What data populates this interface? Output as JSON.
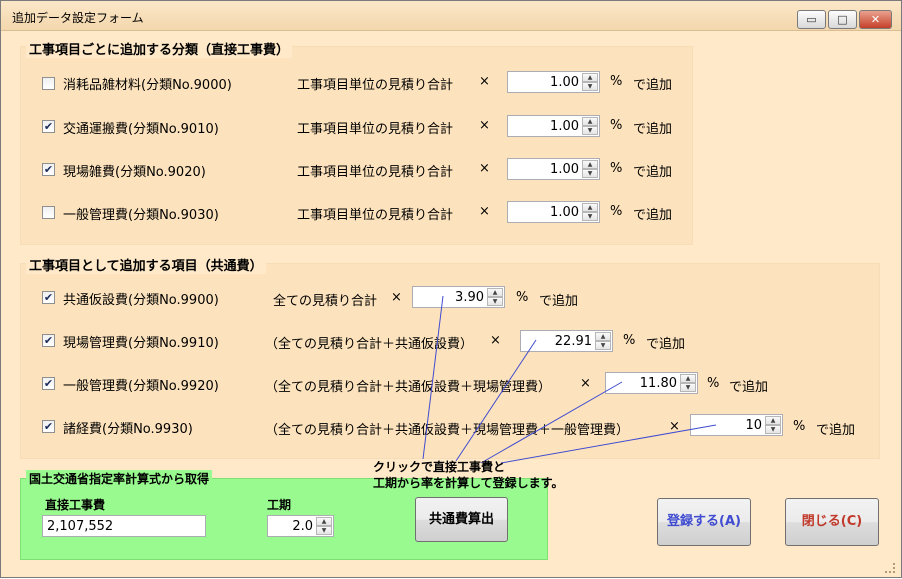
{
  "window": {
    "title": "追加データ設定フォーム",
    "min_glyph": "▭",
    "max_glyph": "□",
    "close_glyph": "✕"
  },
  "group1": {
    "title": "工事項目ごとに追加する分類（直接工事費）",
    "rows": [
      {
        "checked": false,
        "name": "消耗品雑材料(分類No.9000)",
        "formula": "工事項目単位の見積り合計",
        "times": "×",
        "value": "1.00",
        "unit": "%",
        "suffix": "で追加"
      },
      {
        "checked": true,
        "name": "交通運搬費(分類No.9010)",
        "formula": "工事項目単位の見積り合計",
        "times": "×",
        "value": "1.00",
        "unit": "%",
        "suffix": "で追加"
      },
      {
        "checked": true,
        "name": "現場雑費(分類No.9020)",
        "formula": "工事項目単位の見積り合計",
        "times": "×",
        "value": "1.00",
        "unit": "%",
        "suffix": "で追加"
      },
      {
        "checked": false,
        "name": "一般管理費(分類No.9030)",
        "formula": "工事項目単位の見積り合計",
        "times": "×",
        "value": "1.00",
        "unit": "%",
        "suffix": "で追加"
      }
    ]
  },
  "group2": {
    "title": "工事項目として追加する項目（共通費）",
    "rows": [
      {
        "checked": true,
        "name": "共通仮設費(分類No.9900)",
        "formula": "全ての見積り合計",
        "times": "×",
        "value": "3.90",
        "unit": "%",
        "suffix": "で追加"
      },
      {
        "checked": true,
        "name": "現場管理費(分類No.9910)",
        "formula": "（全ての見積り合計＋共通仮設費）",
        "times": "×",
        "value": "22.91",
        "unit": "%",
        "suffix": "で追加"
      },
      {
        "checked": true,
        "name": "一般管理費(分類No.9920)",
        "formula": "（全ての見積り合計＋共通仮設費＋現場管理費）",
        "times": "×",
        "value": "11.80",
        "unit": "%",
        "suffix": "で追加"
      },
      {
        "checked": true,
        "name": "諸経費(分類No.9930)",
        "formula": "（全ての見積り合計＋共通仮設費＋現場管理費＋一般管理費）",
        "times": "×",
        "value": "10",
        "unit": "%",
        "suffix": "で追加"
      }
    ]
  },
  "mlit": {
    "title": "国土交通省指定率計算式から取得",
    "direct_label": "直接工事費",
    "direct_value": "2,107,552",
    "period_label": "工期",
    "period_value": "2.0",
    "calc_button": "共通費算出"
  },
  "annotation": {
    "line1": "クリックで直接工事費と",
    "line2": "工期から率を計算して登録します。"
  },
  "buttons": {
    "register": "登録する(A)",
    "close": "閉じる(C)"
  },
  "colors": {
    "window_bg": "#ffe9c8",
    "group_panel_bg": "#fde3bd",
    "mlit_panel_bg": "#99fb8f",
    "accent_blue": "#3f4bd0",
    "check_mark": "#1c2c5c"
  },
  "icons": {
    "checkbox_checked": "✔",
    "spin_up": "▲",
    "spin_down": "▼"
  }
}
